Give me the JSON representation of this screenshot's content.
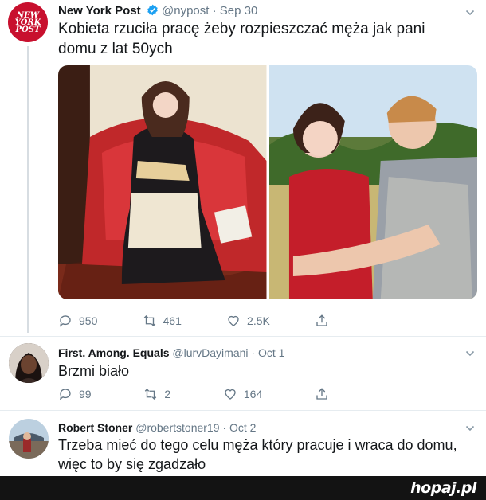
{
  "tweets": [
    {
      "name": "New York Post",
      "handle": "@nypost",
      "date": "Sep 30",
      "avatar_text": [
        "NEW",
        "YORK",
        "POST"
      ],
      "text": "Kobieta rzuciła pracę żeby rozpieszczać męża jak pani domu z lat 50ych",
      "replies": "950",
      "retweets": "461",
      "likes": "2.5K"
    },
    {
      "name": "First. Among. Equals",
      "handle": "@lurvDayimani",
      "date": "Oct 1",
      "text": "Brzmi biało",
      "replies": "99",
      "retweets": "2",
      "likes": "164"
    },
    {
      "name": "Robert Stoner",
      "handle": "@robertstoner19",
      "date": "Oct 2",
      "text": "Trzeba mieć do tego celu męża który pracuje i wraca do domu, więc to by się zgadzało"
    }
  ],
  "logo": "hopaj.pl",
  "colors": {
    "brand_red": "#c8102e",
    "verified_blue": "#1da1f2",
    "muted_text": "#657786",
    "footer_bg": "#131313"
  },
  "icons": [
    "reply-icon",
    "retweet-icon",
    "like-icon",
    "share-icon",
    "verified-badge-icon",
    "chevron-down-icon"
  ]
}
